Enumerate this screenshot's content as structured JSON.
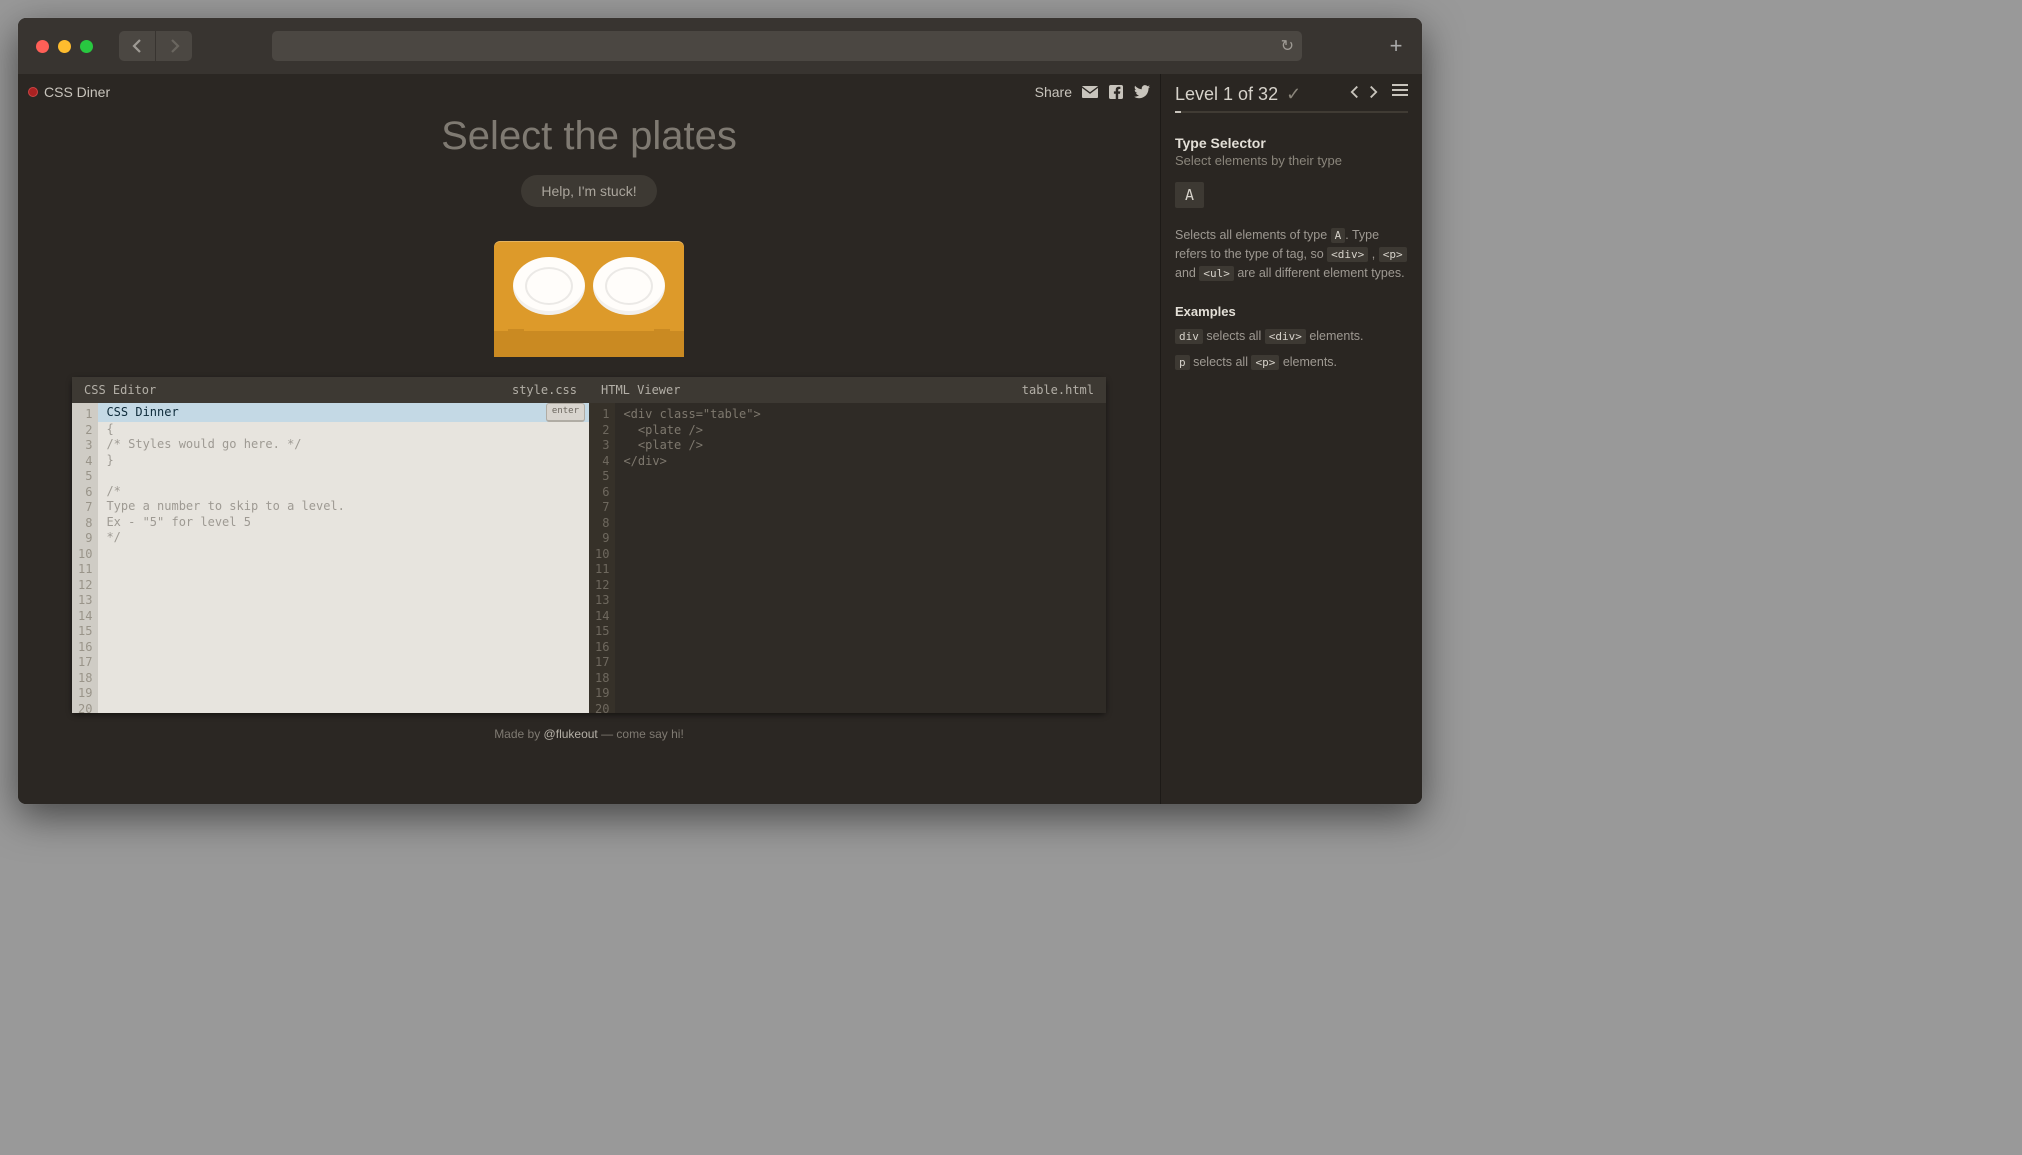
{
  "browser": {
    "tab_title": "CSS Diner"
  },
  "header": {
    "brand": "CSS Diner",
    "share_label": "Share"
  },
  "hero": {
    "order": "Select the plates",
    "help_label": "Help, I'm stuck!"
  },
  "editor": {
    "css_title": "CSS Editor",
    "css_file": "style.css",
    "html_title": "HTML Viewer",
    "html_file": "table.html",
    "line_count": 20,
    "enter_label": "enter",
    "input_value": "CSS Dinner",
    "css_hint_lines": [
      "{",
      "/* Styles would go here. */",
      "}",
      "",
      "/*",
      "Type a number to skip to a level.",
      "Ex - \"5\" for level 5",
      "*/"
    ],
    "html_lines": [
      "<div class=\"table\">",
      "  <plate />",
      "  <plate />",
      "</div>"
    ]
  },
  "footer": {
    "prefix": "Made by ",
    "author": "@flukeout",
    "suffix": " — come say hi!"
  },
  "sidebar": {
    "level_text": "Level 1 of 32",
    "selector_name": "Type Selector",
    "selector_title": "Select elements by their type",
    "syntax": "A",
    "hint_pre": "Selects all elements of type ",
    "hint_a": "A",
    "hint_mid1": ". Type refers to the type of tag, so ",
    "hint_div": "<div>",
    "hint_comma": " , ",
    "hint_p": "<p>",
    "hint_and": " and ",
    "hint_ul": "<ul>",
    "hint_end": " are all different element types.",
    "examples_header": "Examples",
    "ex1_code": "div",
    "ex1_mid": " selects all ",
    "ex1_tag": "<div>",
    "ex1_end": " elements.",
    "ex2_code": "p",
    "ex2_mid": " selects all ",
    "ex2_tag": "<p>",
    "ex2_end": " elements."
  }
}
